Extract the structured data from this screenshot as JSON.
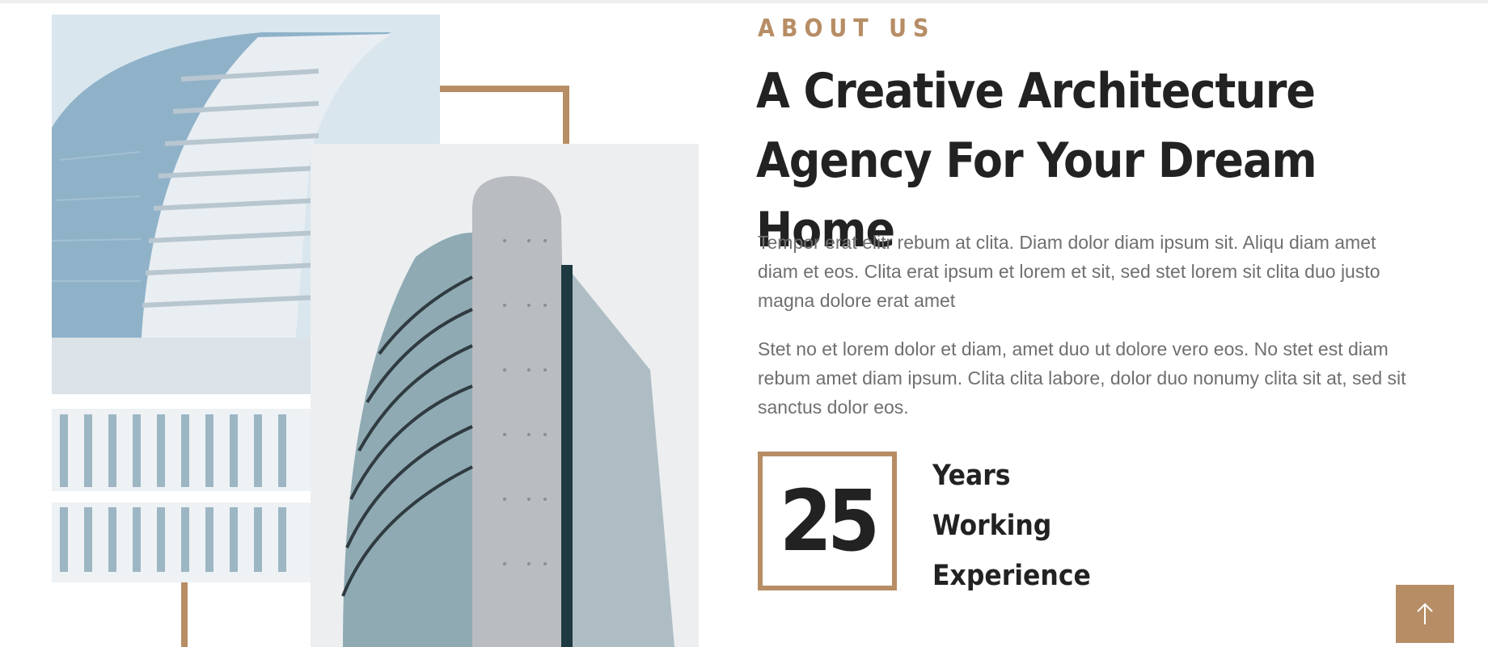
{
  "about": {
    "label": "ABOUT US",
    "headline": "A Creative Architecture Agency For Your Dream Home",
    "paragraphs": [
      "Tempor erat elitr rebum at clita. Diam dolor diam ipsum sit. Aliqu diam amet diam et eos. Clita erat ipsum et lorem et sit, sed stet lorem sit clita duo justo magna dolore erat amet",
      "Stet no et lorem dolor et diam, amet duo ut dolore vero eos. No stet est diam rebum amet diam ipsum. Clita clita labore, dolor duo nonumy clita sit at, sed sit sanctus dolor eos."
    ]
  },
  "stat": {
    "number": "25",
    "label_lines": [
      "Years",
      "Working",
      "Experience"
    ]
  },
  "back_to_top": {
    "icon": "arrow-up-icon"
  },
  "colors": {
    "accent": "#b78d65",
    "heading": "#222222",
    "body_text": "#6f6f6f"
  }
}
